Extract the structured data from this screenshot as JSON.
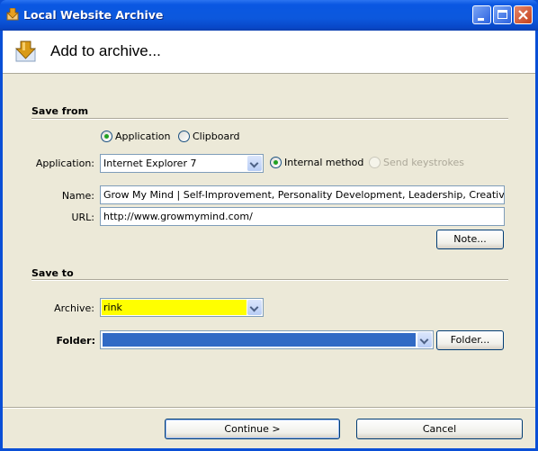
{
  "window": {
    "title": "Local Website Archive",
    "controls": {
      "minimize": "minimize",
      "maximize": "maximize",
      "close": "close"
    }
  },
  "header": {
    "title": "Add to archive..."
  },
  "save_from": {
    "section_title": "Save from",
    "source_options": [
      {
        "label": "Application",
        "checked": true
      },
      {
        "label": "Clipboard",
        "checked": false
      }
    ],
    "application_label": "Application:",
    "application_value": "Internet Explorer 7",
    "method_options": [
      {
        "label": "Internal method",
        "checked": true,
        "enabled": true
      },
      {
        "label": "Send keystrokes",
        "checked": false,
        "enabled": false
      }
    ],
    "name_label": "Name:",
    "name_value": "Grow My Mind | Self-Improvement, Personality Development, Leadership, Creativity - Microsoft Internet Explorer",
    "url_label": "URL:",
    "url_value": "http://www.growmymind.com/",
    "note_button": "Note..."
  },
  "save_to": {
    "section_title": "Save to",
    "archive_label": "Archive:",
    "archive_value": "rink",
    "archive_color": "#ffff00",
    "folder_label": "Folder:",
    "folder_value": "",
    "folder_color": "#316ac5",
    "folder_button": "Folder..."
  },
  "footer": {
    "continue_button": "Continue >",
    "cancel_button": "Cancel"
  }
}
